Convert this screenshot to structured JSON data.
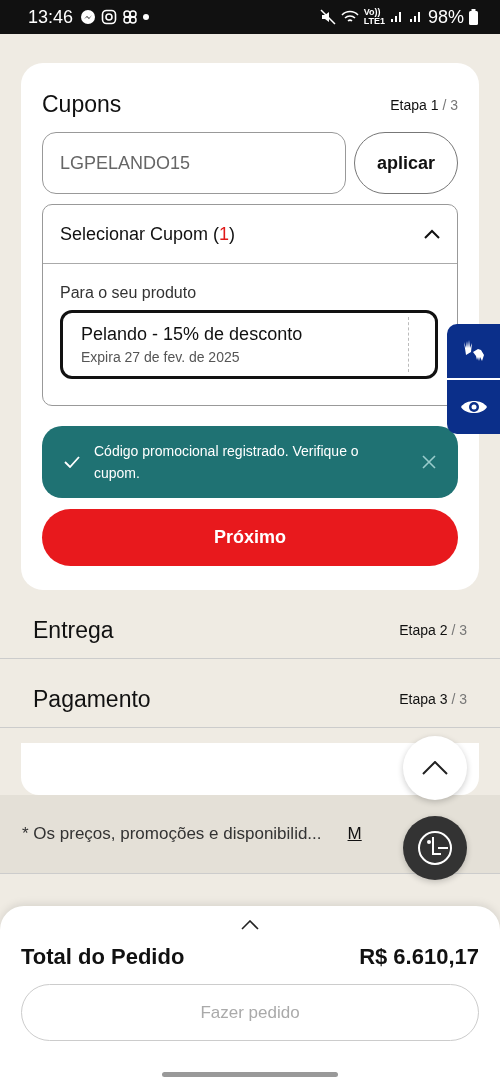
{
  "status_bar": {
    "time": "13:46",
    "volte": "Vo))",
    "network": "LTE1",
    "battery": "98%"
  },
  "coupons": {
    "title": "Cupons",
    "step": {
      "label": "Etapa",
      "current": "1",
      "total": "/ 3"
    },
    "code_field": {
      "value": "LGPELANDO15"
    },
    "apply_button": "aplicar",
    "selector": {
      "label_before": "Selecionar Cupom (",
      "count": "1",
      "label_after": ")",
      "expanded": true,
      "section_label": "Para o seu produto",
      "items": [
        {
          "title": "Pelando - 15% de desconto",
          "expiry": "Expira 27 de fev. de 2025",
          "selected": true
        }
      ]
    },
    "toast": {
      "message": "Código promocional registrado. Verifique o cupom."
    },
    "next_button": "Próximo"
  },
  "steps": [
    {
      "title": "Entrega",
      "label": "Etapa",
      "current": "2",
      "total": "/ 3"
    },
    {
      "title": "Pagamento",
      "label": "Etapa",
      "current": "3",
      "total": "/ 3"
    }
  ],
  "disclaimer": {
    "text": "* Os preços, promoções e disponibilid...",
    "link": "M"
  },
  "order": {
    "total_label": "Total do Pedido",
    "total_value": "R$ 6.610,17",
    "place_button": {
      "label": "Fazer pedido",
      "disabled": true
    }
  }
}
